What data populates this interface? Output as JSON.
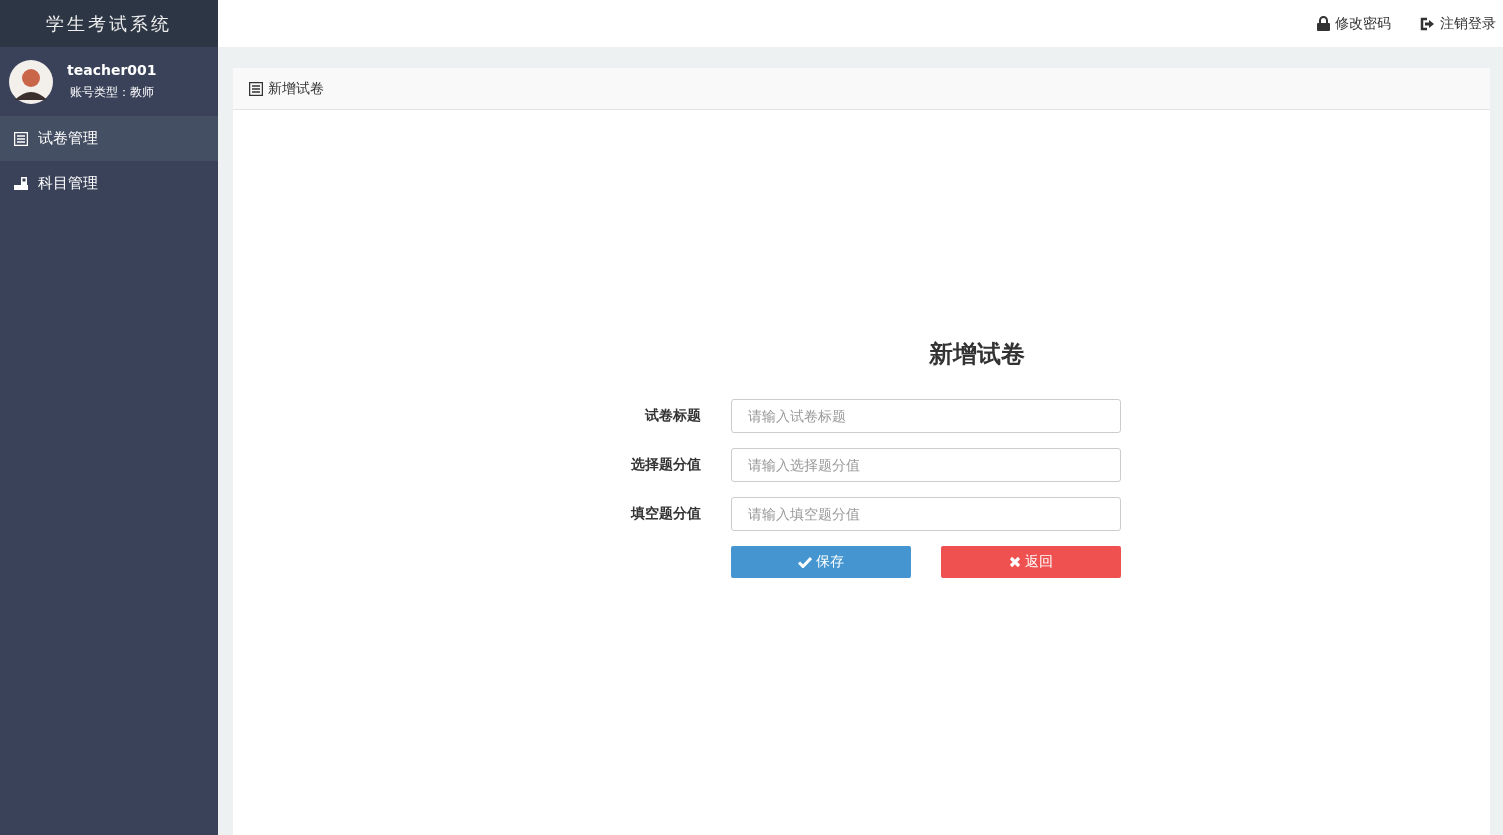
{
  "app_title": "学生考试系统",
  "user": {
    "name": "teacher001",
    "role": "账号类型：教师"
  },
  "sidebar": {
    "items": [
      {
        "label": "试卷管理",
        "kind": "list",
        "selected": true
      },
      {
        "label": "科目管理",
        "kind": "desk",
        "selected": false
      }
    ]
  },
  "top_bar": {
    "links": [
      {
        "label": "修改密码",
        "kind": "lock"
      },
      {
        "label": "注销登录",
        "kind": "logout"
      }
    ]
  },
  "panel": {
    "title": "新增试卷"
  },
  "form": {
    "heading": "新增试卷",
    "fields": [
      {
        "label": "试卷标题",
        "placeholder": "请输入试卷标题"
      },
      {
        "label": "选择题分值",
        "placeholder": "请输入选择题分值"
      },
      {
        "label": "填空题分值",
        "placeholder": "请输入填空题分值"
      }
    ],
    "buttons": [
      {
        "label": "保存",
        "kind": "save"
      },
      {
        "label": "返回",
        "kind": "back"
      }
    ]
  }
}
